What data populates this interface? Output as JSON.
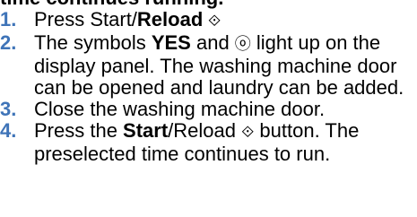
{
  "heading": "time continues running.",
  "steps": [
    {
      "number": "1.",
      "parts": [
        "Press Start/",
        "Reload",
        " ⟐"
      ]
    },
    {
      "number": "2.",
      "parts": [
        "The symbols ",
        "YES",
        " and ",
        "ⓞ",
        " light up on the display panel. The washing machine door can be opened and laundry can be added."
      ]
    },
    {
      "number": "3.",
      "parts": [
        "Close the washing machine door."
      ]
    },
    {
      "number": "4.",
      "parts": [
        "Press the ",
        "Start",
        "/Reload ",
        "⟐",
        " button. The preselected time continues to run."
      ]
    }
  ]
}
